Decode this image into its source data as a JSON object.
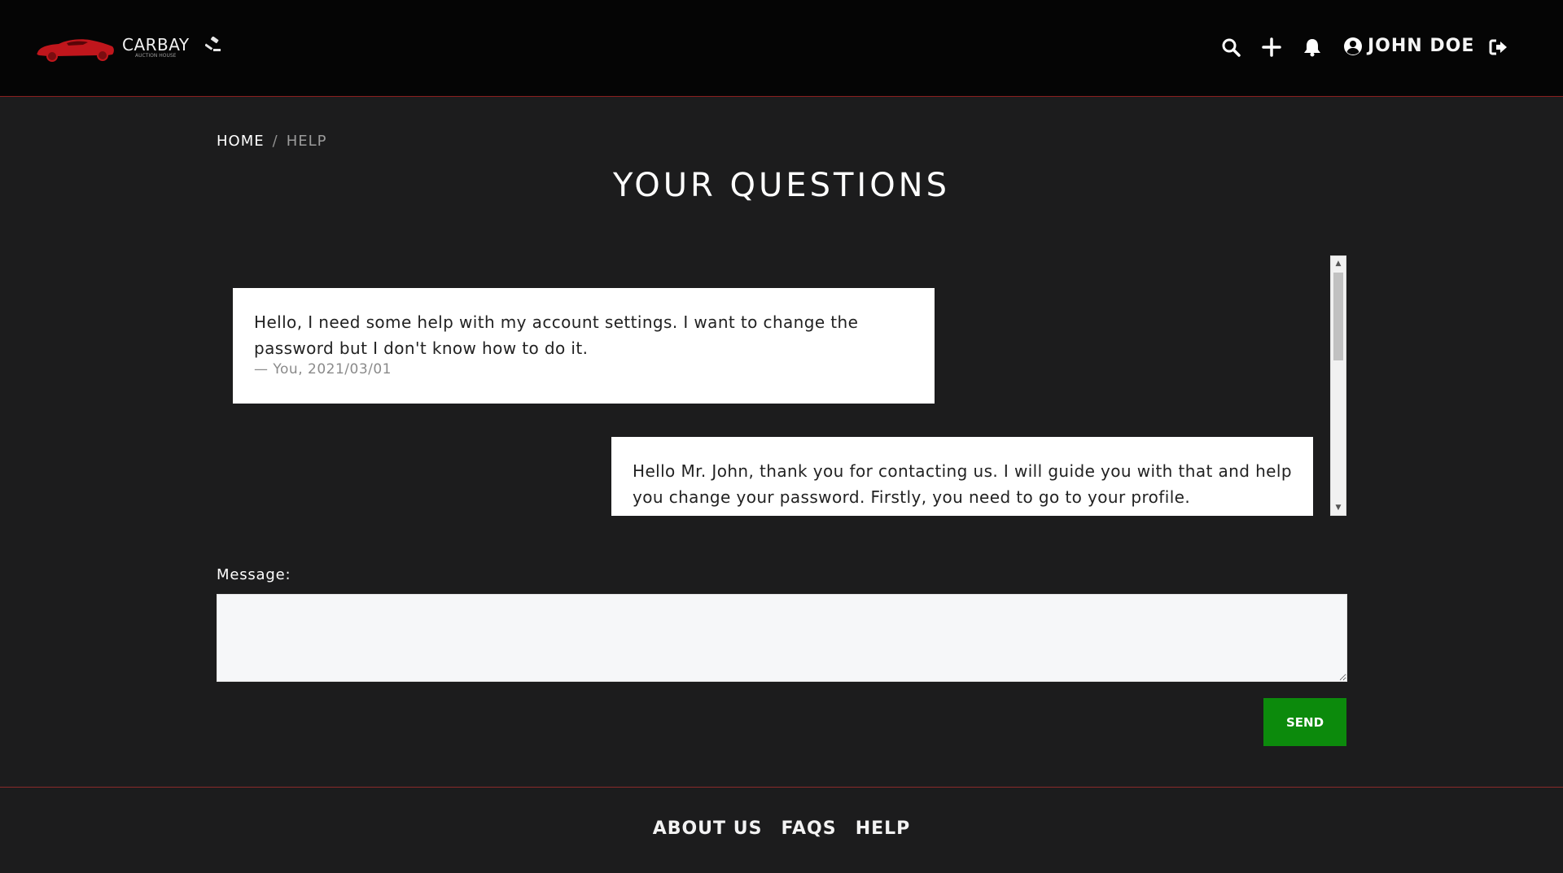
{
  "header": {
    "logo_name": "CARBAY",
    "logo_sub": "AUCTION HOUSE",
    "user_name": "JOHN DOE",
    "icons": [
      "search-icon",
      "plus-icon",
      "bell-icon",
      "user-circle-icon",
      "logout-icon"
    ],
    "accent": "#c0161c"
  },
  "breadcrumb": {
    "home": "HOME",
    "separator": "/",
    "current": "HELP"
  },
  "page": {
    "title": "YOUR QUESTIONS"
  },
  "messages": [
    {
      "text": "Hello, I need some help with my account settings. I want to change the password but I don't know how to do it.",
      "meta": "— You, 2021/03/01"
    },
    {
      "text": "Hello Mr. John, thank you for contacting us. I will guide you with that and help you change your password. Firstly, you need to go to your profile."
    }
  ],
  "form": {
    "label": "Message:",
    "value": "",
    "send_label": "SEND",
    "send_color": "#0c8a0c"
  },
  "footer": {
    "links": [
      "ABOUT US",
      "FAQS",
      "HELP"
    ]
  }
}
